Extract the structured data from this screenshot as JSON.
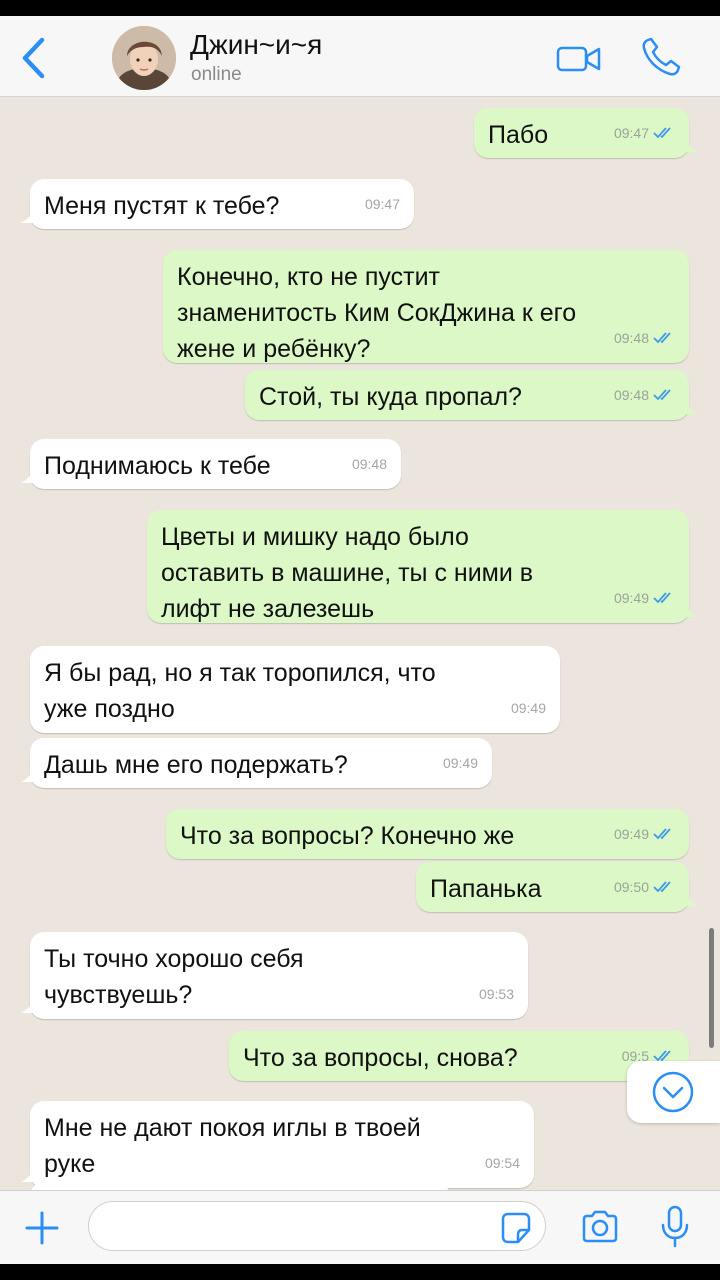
{
  "header": {
    "contact_name": "Джин~и~я",
    "contact_status": "online"
  },
  "icons": {
    "back": "chevron-left-icon",
    "video": "video-camera-icon",
    "call": "phone-icon",
    "scroll_down": "chevron-down-circle-icon",
    "attach": "plus-icon",
    "sticker": "sticker-icon",
    "camera": "camera-icon",
    "mic": "microphone-icon"
  },
  "colors": {
    "accent": "#2b8ef5",
    "chat_background": "#ece5dd",
    "outgoing_bubble": "#dcf8c6",
    "incoming_bubble": "#ffffff",
    "read_ticks": "#3d9be9"
  },
  "messages": [
    {
      "dir": "out",
      "text": "Пабо",
      "time": "09:47",
      "read": true
    },
    {
      "dir": "in",
      "text": "Меня пустят к тебе?",
      "time": "09:47"
    },
    {
      "dir": "out",
      "text": "Конечно, кто не пустит знаменитость Ким СокДжина к его жене и ребёнку?",
      "time": "09:48",
      "read": true
    },
    {
      "dir": "out",
      "text": "Стой, ты куда пропал?",
      "time": "09:48",
      "read": true
    },
    {
      "dir": "in",
      "text": "Поднимаюсь к тебе",
      "time": "09:48"
    },
    {
      "dir": "out",
      "text": "Цветы и мишку надо было оставить в машине, ты с ними в лифт не залезешь",
      "time": "09:49",
      "read": true
    },
    {
      "dir": "in",
      "text": "Я бы рад, но я так торопился, что уже поздно",
      "time": "09:49"
    },
    {
      "dir": "in",
      "text": "Дашь мне его подержать?",
      "time": "09:49"
    },
    {
      "dir": "out",
      "text": "Что за вопросы? Конечно же",
      "time": "09:49",
      "read": true
    },
    {
      "dir": "out",
      "text": "Папанька",
      "time": "09:50",
      "read": true
    },
    {
      "dir": "in",
      "text": "Ты точно хорошо себя чувствуешь?",
      "time": "09:53"
    },
    {
      "dir": "out",
      "text": "Что за вопросы, снова?",
      "time": "09:5",
      "read": true
    },
    {
      "dir": "in",
      "text": "Мне не дают покоя иглы в твоей руке",
      "time": "09:54"
    }
  ],
  "composer": {
    "placeholder": "",
    "value": ""
  }
}
